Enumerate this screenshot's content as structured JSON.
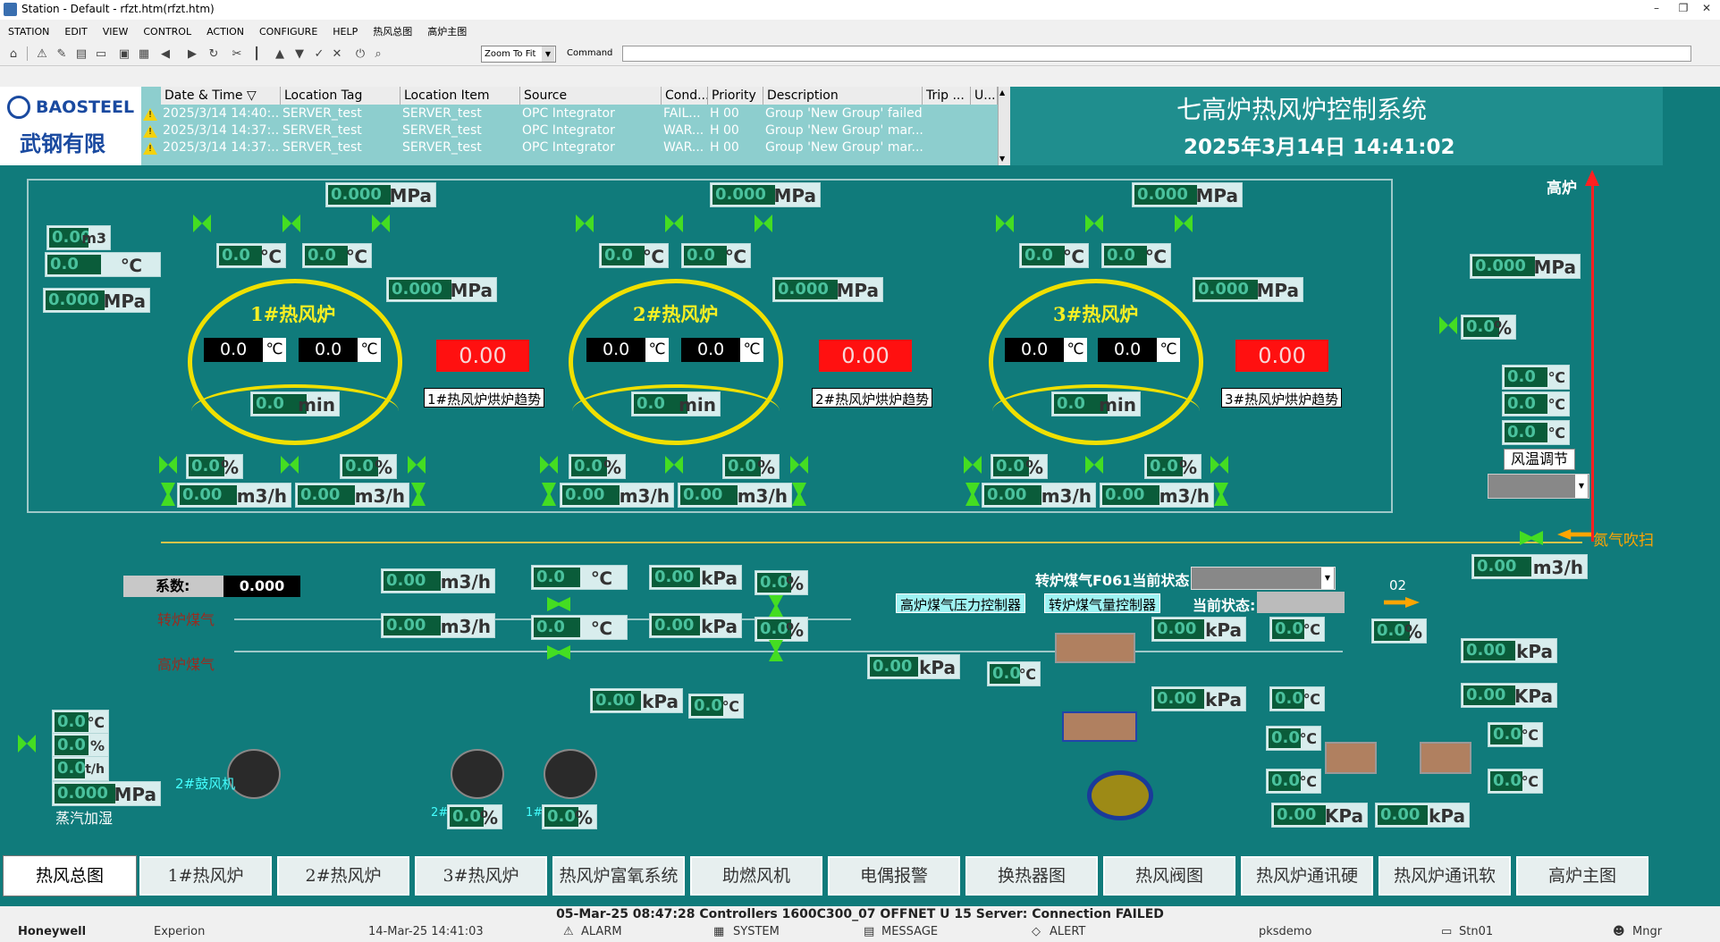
{
  "window": {
    "title": "Station - Default - rfzt.htm(rfzt.htm)"
  },
  "menu": [
    "STATION",
    "EDIT",
    "VIEW",
    "CONTROL",
    "ACTION",
    "CONFIGURE",
    "HELP",
    "热风总图",
    "高炉主图"
  ],
  "toolbar": {
    "zoom": "Zoom To Fit",
    "command_label": "Command"
  },
  "logo": {
    "brand": "BAOSTEEL",
    "cn": "武钢有限"
  },
  "alarm_table": {
    "headers": [
      "Date & Time ▽",
      "Location Tag",
      "Location Item",
      "Source",
      "Cond...",
      "Priority",
      "Description",
      "Trip ...",
      "U..."
    ],
    "rows": [
      [
        "2025/3/14 14:40:...",
        "SERVER_test",
        "SERVER_test",
        "OPC Integrator",
        "FAIL...",
        "H 00",
        "Group 'New Group' failed"
      ],
      [
        "2025/3/14 14:37:...",
        "SERVER_test",
        "SERVER_test",
        "OPC Integrator",
        "WAR...",
        "H 00",
        "Group 'New Group' mar..."
      ],
      [
        "2025/3/14 14:37:...",
        "SERVER_test",
        "SERVER_test",
        "OPC Integrator",
        "WAR...",
        "H 00",
        "Group 'New Group' mar..."
      ]
    ]
  },
  "header": {
    "system_name": "七高炉热风炉控制系统",
    "datetime": "2025年3月14日   14:41:02",
    "blast_furnace": "高炉"
  },
  "furnaces": [
    {
      "name": "1#热风炉",
      "t1": "0.0",
      "t2": "0.0",
      "red": "0.00",
      "trend": "1#热风炉烘炉趋势",
      "min": "min"
    },
    {
      "name": "2#热风炉",
      "t1": "0.0",
      "t2": "0.0",
      "red": "0.00",
      "trend": "2#热风炉烘炉趋势",
      "min": "min"
    },
    {
      "name": "3#热风炉",
      "t1": "0.0",
      "t2": "0.0",
      "red": "0.00",
      "trend": "3#热风炉烘炉趋势",
      "min": "min"
    }
  ],
  "units": {
    "mpa": "MPa",
    "c": "℃",
    "m3h": "m3/h",
    "kpa": "kPa",
    "KPa": "KPa",
    "pct": "%",
    "m3": "m3",
    "t_h": "t/h",
    "min": "min"
  },
  "values": {
    "zero3": "0.000",
    "zero2": "0.00",
    "zero1": "0.0"
  },
  "labels": {
    "coef": "系数:",
    "coef_val": "0.000",
    "gas1": "转炉煤气",
    "gas2": "高炉煤气",
    "f061": "转炉煤气F061当前状态:",
    "cur_state": "当前状态:",
    "ctrl1": "高炉煤气压力控制器",
    "ctrl2": "转炉煤气量控制器",
    "nitrogen": "氮气吹扫",
    "wind_temp": "风温调节",
    "code02": "02",
    "fan2": "2#鼓风机",
    "steam": "蒸汽加湿",
    "tag2": "2#",
    "tag1": "1#"
  },
  "nav": [
    "热风总图",
    "1#热风炉",
    "2#热风炉",
    "3#热风炉",
    "热风炉富氧系统",
    "助燃风机",
    "电偶报警",
    "换热器图",
    "热风阀图",
    "热风炉通讯硬",
    "热风炉通讯软",
    "高炉主图"
  ],
  "status": {
    "line1": "05-Mar-25   08:47:28  Controllers    1600C300_07    OFFNET    U 15 Server: Connection FAILED",
    "brand": "Honeywell",
    "experion": "Experion",
    "date": "14-Mar-25   14:41:03",
    "alarm": "ALARM",
    "system": "SYSTEM",
    "message": "MESSAGE",
    "alert": "ALERT",
    "node": "pksdemo",
    "station": "Stn01",
    "user": "Mngr"
  },
  "colors": {
    "background": "#107b7b",
    "furnace_ring": "#f0e000",
    "alarm_red": "#ff1010",
    "value_green": "#0a5c3a"
  }
}
